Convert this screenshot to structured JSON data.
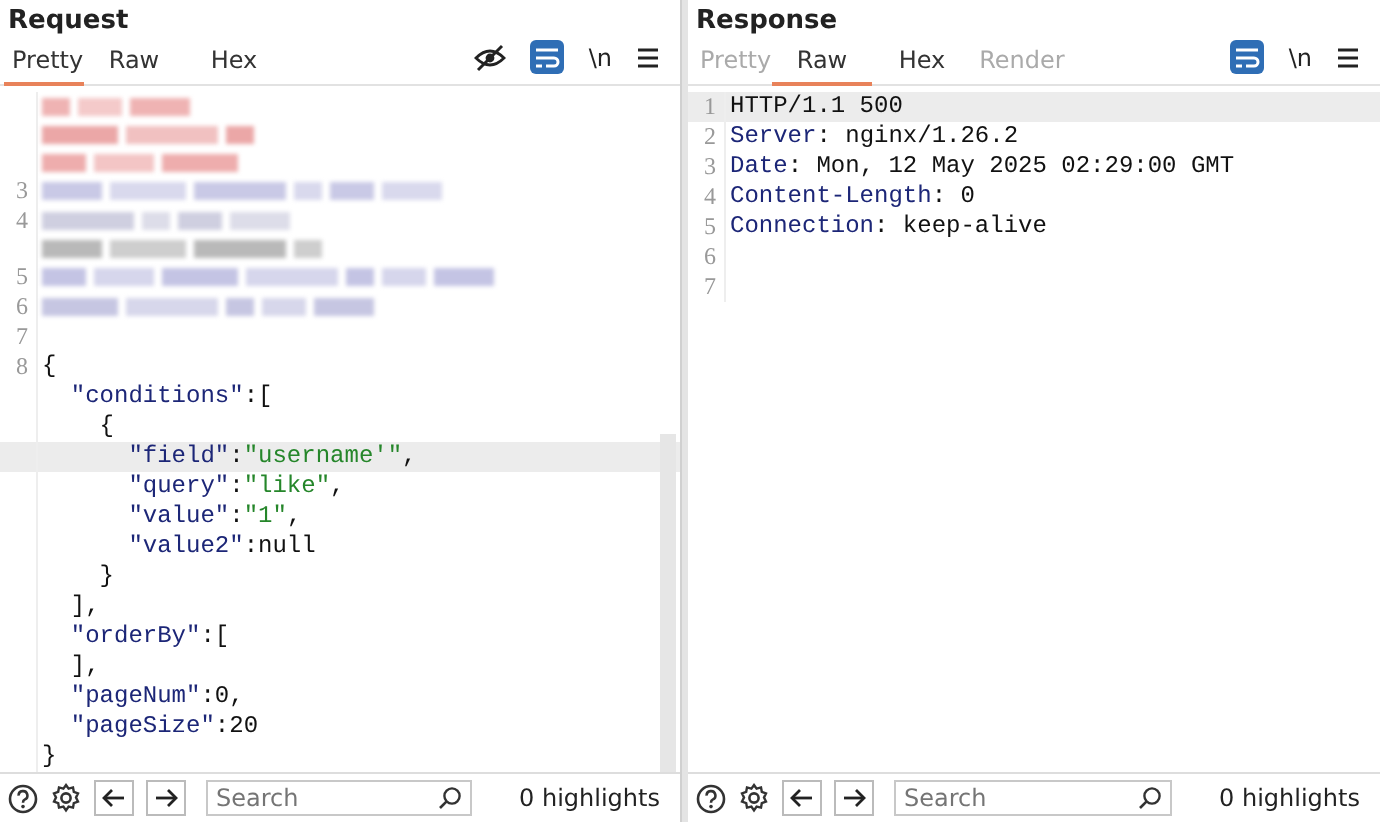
{
  "request": {
    "title": "Request",
    "tabs": [
      {
        "label": "Pretty",
        "selected": true,
        "disabled": false
      },
      {
        "label": "Raw",
        "selected": false,
        "disabled": false
      },
      {
        "label": "Hex",
        "selected": false,
        "disabled": false
      }
    ],
    "toolbar": [
      {
        "kind": "hide"
      },
      {
        "kind": "wrap",
        "on": true
      },
      {
        "kind": "newline",
        "label": "\\n"
      },
      {
        "kind": "menu"
      }
    ],
    "lines": [
      {
        "kind": "redacted",
        "highlighted": false,
        "rows": [
          {
            "color": "#efb3b3"
          },
          {
            "color": "#eba7a7"
          },
          {
            "color": "#eeadad"
          }
        ]
      },
      {
        "number": "3",
        "kind": "redacted",
        "highlighted": false,
        "rows": [
          {
            "color": "#c9c9e6"
          }
        ]
      },
      {
        "number": "4",
        "kind": "redacted",
        "highlighted": false,
        "rows": [
          {
            "color": "#cfcfe0"
          },
          {
            "color": "#b9b9b9"
          }
        ]
      },
      {
        "number": "5",
        "kind": "redacted",
        "highlighted": false,
        "rows": [
          {
            "color": "#c4c4e4"
          }
        ]
      },
      {
        "number": "6",
        "kind": "redacted",
        "highlighted": false,
        "rows": [
          {
            "color": "#c6c6e2"
          }
        ]
      },
      {
        "number": "7",
        "kind": "blank",
        "highlighted": false
      },
      {
        "number": "8",
        "kind": "code",
        "highlighted": false,
        "tokens": [
          {
            "kind": "plain",
            "text": "{"
          }
        ]
      },
      {
        "kind": "code",
        "highlighted": false,
        "tokens": [
          {
            "kind": "key",
            "text": "  \"conditions\""
          },
          {
            "kind": "plain",
            "text": ":["
          }
        ]
      },
      {
        "kind": "code",
        "highlighted": false,
        "tokens": [
          {
            "kind": "plain",
            "text": "    {"
          }
        ]
      },
      {
        "kind": "code",
        "highlighted": true,
        "tokens": [
          {
            "kind": "key",
            "text": "      \"field\""
          },
          {
            "kind": "plain",
            "text": ":"
          },
          {
            "kind": "string",
            "text": "\"username'\""
          },
          {
            "kind": "plain",
            "text": ","
          }
        ]
      },
      {
        "kind": "code",
        "highlighted": false,
        "tokens": [
          {
            "kind": "key",
            "text": "      \"query\""
          },
          {
            "kind": "plain",
            "text": ":"
          },
          {
            "kind": "string",
            "text": "\"like\""
          },
          {
            "kind": "plain",
            "text": ","
          }
        ]
      },
      {
        "kind": "code",
        "highlighted": false,
        "tokens": [
          {
            "kind": "key",
            "text": "      \"value\""
          },
          {
            "kind": "plain",
            "text": ":"
          },
          {
            "kind": "string",
            "text": "\"1\""
          },
          {
            "kind": "plain",
            "text": ","
          }
        ]
      },
      {
        "kind": "code",
        "highlighted": false,
        "tokens": [
          {
            "kind": "key",
            "text": "      \"value2\""
          },
          {
            "kind": "plain",
            "text": ":null"
          }
        ]
      },
      {
        "kind": "code",
        "highlighted": false,
        "tokens": [
          {
            "kind": "plain",
            "text": "    }"
          }
        ]
      },
      {
        "kind": "code",
        "highlighted": false,
        "tokens": [
          {
            "kind": "plain",
            "text": "  ],"
          }
        ]
      },
      {
        "kind": "code",
        "highlighted": false,
        "tokens": [
          {
            "kind": "key",
            "text": "  \"orderBy\""
          },
          {
            "kind": "plain",
            "text": ":["
          }
        ]
      },
      {
        "kind": "code",
        "highlighted": false,
        "tokens": [
          {
            "kind": "plain",
            "text": "  ],"
          }
        ]
      },
      {
        "kind": "code",
        "highlighted": false,
        "tokens": [
          {
            "kind": "key",
            "text": "  \"pageNum\""
          },
          {
            "kind": "plain",
            "text": ":0,"
          }
        ]
      },
      {
        "kind": "code",
        "highlighted": false,
        "tokens": [
          {
            "kind": "key",
            "text": "  \"pageSize\""
          },
          {
            "kind": "plain",
            "text": ":20"
          }
        ]
      },
      {
        "kind": "code",
        "highlighted": false,
        "tokens": [
          {
            "kind": "plain",
            "text": "}"
          }
        ]
      }
    ],
    "search": {
      "placeholder": "Search"
    },
    "highlights": "0 highlights"
  },
  "response": {
    "title": "Response",
    "tabs": [
      {
        "label": "Pretty",
        "selected": false,
        "disabled": true
      },
      {
        "label": "Raw",
        "selected": true,
        "disabled": false
      },
      {
        "label": "Hex",
        "selected": false,
        "disabled": false
      },
      {
        "label": "Render",
        "selected": false,
        "disabled": true
      }
    ],
    "toolbar": [
      {
        "kind": "wrap",
        "on": true
      },
      {
        "kind": "newline",
        "label": "\\n"
      },
      {
        "kind": "menu"
      }
    ],
    "lines": [
      {
        "number": "1",
        "kind": "code",
        "highlighted": true,
        "tokens": [
          {
            "kind": "plain",
            "text": "HTTP/1.1 500"
          }
        ]
      },
      {
        "number": "2",
        "kind": "code",
        "highlighted": false,
        "tokens": [
          {
            "kind": "key",
            "text": "Server"
          },
          {
            "kind": "plain",
            "text": ": nginx/1.26.2"
          }
        ]
      },
      {
        "number": "3",
        "kind": "code",
        "highlighted": false,
        "tokens": [
          {
            "kind": "key",
            "text": "Date"
          },
          {
            "kind": "plain",
            "text": ": Mon, 12 May 2025 02:29:00 GMT"
          }
        ]
      },
      {
        "number": "4",
        "kind": "code",
        "highlighted": false,
        "tokens": [
          {
            "kind": "key",
            "text": "Content-Length"
          },
          {
            "kind": "plain",
            "text": ": 0"
          }
        ]
      },
      {
        "number": "5",
        "kind": "code",
        "highlighted": false,
        "tokens": [
          {
            "kind": "key",
            "text": "Connection"
          },
          {
            "kind": "plain",
            "text": ": keep-alive"
          }
        ]
      },
      {
        "number": "6",
        "kind": "blank",
        "highlighted": false
      },
      {
        "number": "7",
        "kind": "blank",
        "highlighted": false
      }
    ],
    "search": {
      "placeholder": "Search"
    },
    "highlights": "0 highlights"
  }
}
